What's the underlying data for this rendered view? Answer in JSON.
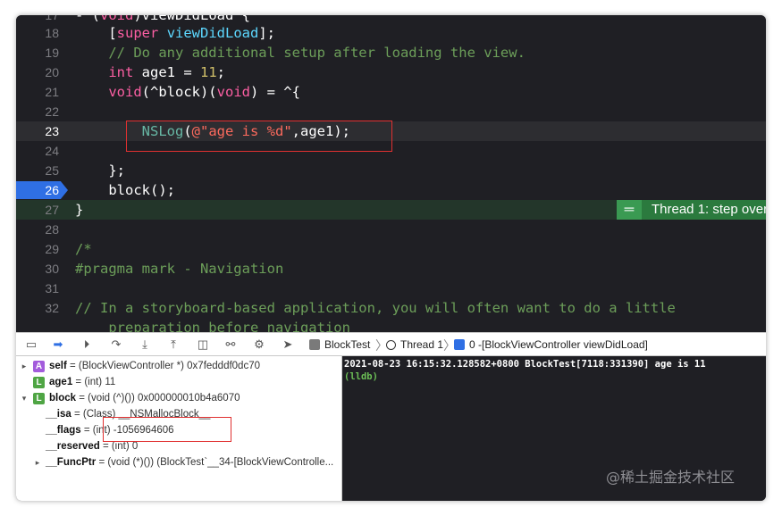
{
  "editor": {
    "lines": [
      {
        "num": "17",
        "code": "- (void)viewDidLoad {"
      },
      {
        "num": "18",
        "code": "    [super viewDidLoad];"
      },
      {
        "num": "19",
        "code": "    // Do any additional setup after loading the view."
      },
      {
        "num": "20",
        "code": "    int age1 = 11;"
      },
      {
        "num": "21",
        "code": "    void(^block)(void) = ^{"
      },
      {
        "num": "22",
        "code": ""
      },
      {
        "num": "23",
        "code": "        NSLog(@\"age is %d\",age1);"
      },
      {
        "num": "24",
        "code": ""
      },
      {
        "num": "25",
        "code": "    };"
      },
      {
        "num": "26",
        "code": "    block();"
      },
      {
        "num": "27",
        "code": "}"
      },
      {
        "num": "28",
        "code": ""
      },
      {
        "num": "29",
        "code": "/*"
      },
      {
        "num": "30",
        "code": "#pragma mark - Navigation"
      },
      {
        "num": "31",
        "code": ""
      },
      {
        "num": "32",
        "code": "// In a storyboard-based application, you will often want to do a little"
      },
      {
        "num": "",
        "code": "    preparation before navigation"
      }
    ],
    "thread_badge": "Thread 1: step over",
    "colors": {
      "background": "#1f1f24",
      "keyword": "#fc5fa3",
      "comment": "#6c9e59",
      "string": "#fc6a5d",
      "number": "#d0bf69",
      "breakpoint": "#2f6fe4",
      "thread_badge": "#2b7a3e"
    }
  },
  "debug_bar": {
    "icons": [
      "hide-debug-area-icon",
      "breakpoints-toggle-icon",
      "continue-icon",
      "step-over-icon",
      "step-into-icon",
      "step-out-icon",
      "view-debugger-icon",
      "memory-graph-icon",
      "environment-overrides-icon",
      "simulate-location-icon"
    ],
    "breadcrumbs": [
      "BlockTest",
      "Thread 1",
      "0 -[BlockViewController viewDidLoad]"
    ]
  },
  "variables": [
    {
      "indent": 0,
      "disclosure": "▸",
      "badge": "A",
      "badge_color": "#a35cdc",
      "name": "self",
      "value": " = (BlockViewController *) 0x7fedddf0dc70"
    },
    {
      "indent": 0,
      "disclosure": "",
      "badge": "L",
      "badge_color": "#4fa544",
      "name": "age1",
      "value": " = (int) 11"
    },
    {
      "indent": 0,
      "disclosure": "▾",
      "badge": "L",
      "badge_color": "#4fa544",
      "name": "block",
      "value": " = (void (^)()) 0x000000010b4a6070"
    },
    {
      "indent": 1,
      "disclosure": "",
      "badge": "",
      "badge_color": "",
      "name": "__isa",
      "value": " = (Class) __NSMallocBlock__"
    },
    {
      "indent": 1,
      "disclosure": "",
      "badge": "",
      "badge_color": "",
      "name": "__flags",
      "value": " = (int) -1056964606"
    },
    {
      "indent": 1,
      "disclosure": "",
      "badge": "",
      "badge_color": "",
      "name": "__reserved",
      "value": " = (int) 0"
    },
    {
      "indent": 1,
      "disclosure": "▸",
      "badge": "",
      "badge_color": "",
      "name": "__FuncPtr",
      "value": " = (void (*)()) (BlockTest`__34-[BlockViewControlle..."
    }
  ],
  "console": {
    "lines": [
      "2021-08-23 16:15:32.128582+0800 BlockTest[7118:331390] age is 11",
      "(lldb)"
    ]
  },
  "watermark": "@稀土掘金技术社区"
}
